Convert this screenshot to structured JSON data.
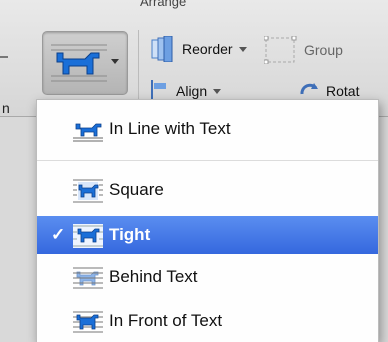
{
  "ribbon": {
    "group_title": "Arrange",
    "reorder_label": "Reorder",
    "group_label": "Group",
    "align_label": "Align",
    "rotate_label": "Rotat",
    "left_cut_text": "n"
  },
  "menu": {
    "items": [
      {
        "label": "In Line with Text"
      },
      {
        "label": "Square"
      },
      {
        "label": "Tight",
        "checkmark": "✓"
      },
      {
        "label": "Behind Text"
      },
      {
        "label": "In Front of Text"
      }
    ]
  },
  "colors": {
    "selection": "#3a6fe2",
    "icon_blue": "#1a6fd8"
  }
}
